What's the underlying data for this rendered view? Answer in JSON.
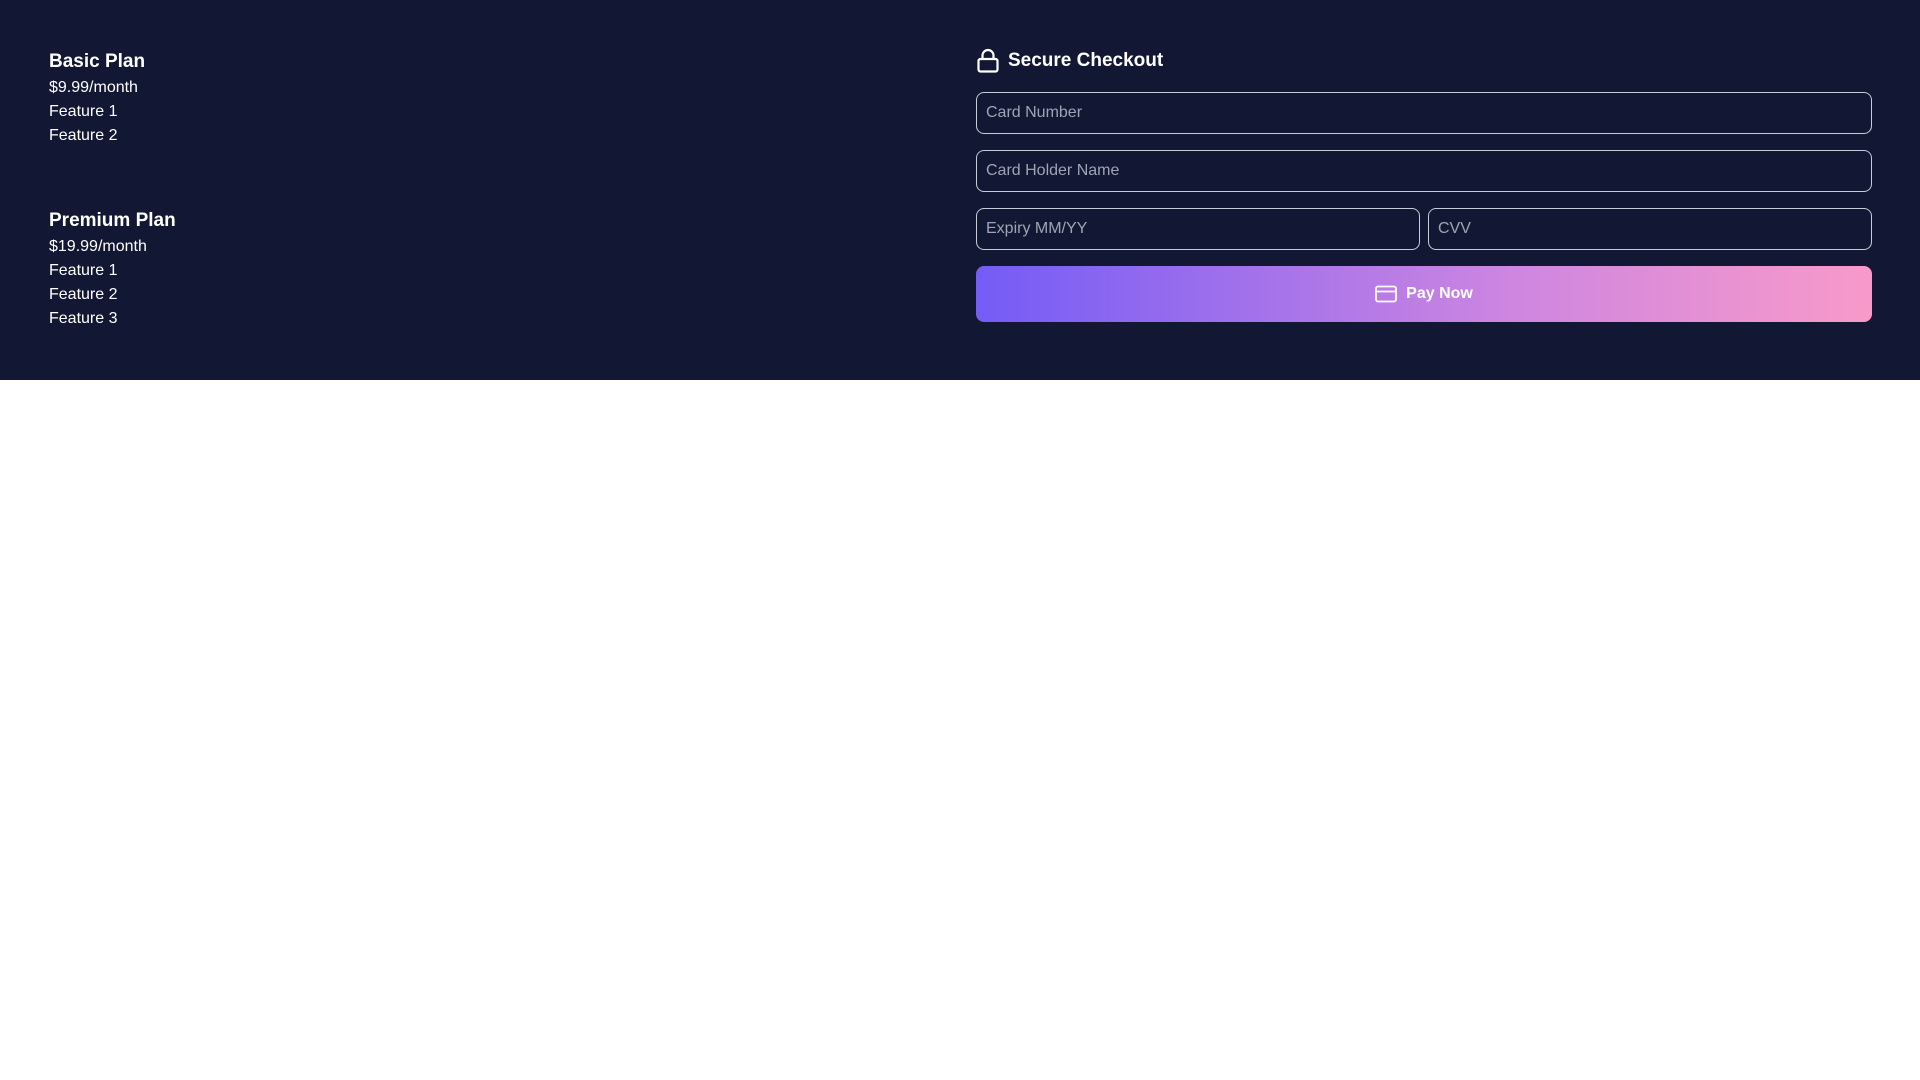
{
  "plans": [
    {
      "title": "Basic Plan",
      "price": "$9.99/month",
      "features": [
        "Feature 1",
        "Feature 2"
      ]
    },
    {
      "title": "Premium Plan",
      "price": "$19.99/month",
      "features": [
        "Feature 1",
        "Feature 2",
        "Feature 3"
      ]
    }
  ],
  "checkout": {
    "title": "Secure Checkout",
    "title_icon": "lock-icon",
    "fields": {
      "card_number": {
        "placeholder": "Card Number",
        "value": ""
      },
      "card_holder": {
        "placeholder": "Card Holder Name",
        "value": ""
      },
      "expiry": {
        "placeholder": "Expiry MM/YY",
        "value": ""
      },
      "cvv": {
        "placeholder": "CVV",
        "value": ""
      }
    },
    "pay_button": {
      "label": "Pay Now",
      "icon": "credit-card-icon"
    }
  },
  "colors": {
    "panel_background": "#121733",
    "page_background": "#ffffff",
    "text": "#ffffff",
    "input_border": "#c9ccd8",
    "button_gradient_start": "#745cf6",
    "button_gradient_end": "#f89ac9"
  }
}
